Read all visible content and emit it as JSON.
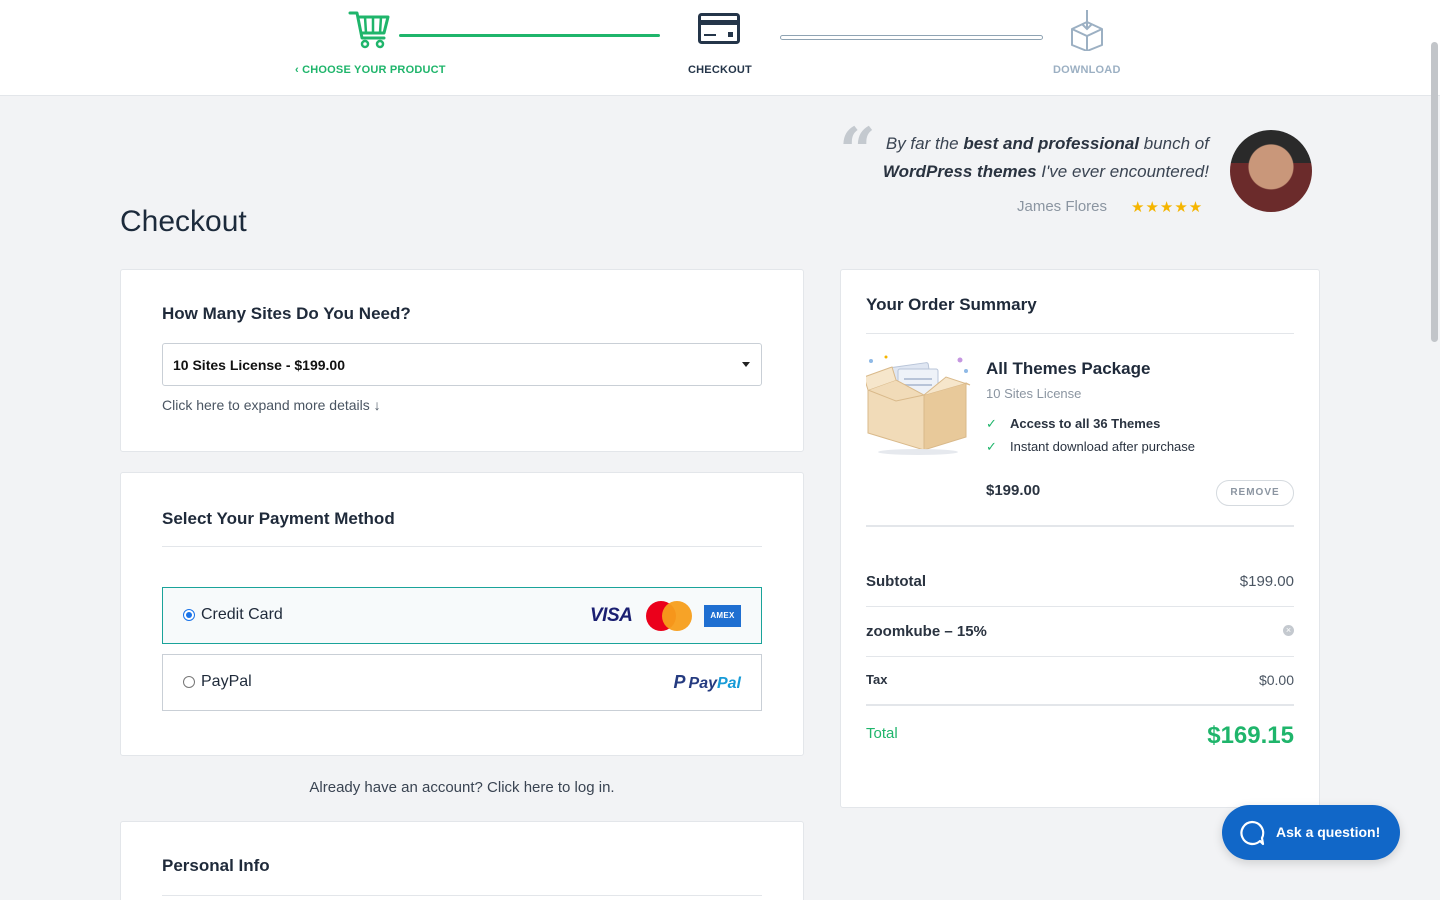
{
  "steps": [
    {
      "label": "‹ CHOOSE YOUR PRODUCT",
      "state": "done",
      "icon": "cart-icon"
    },
    {
      "label": "CHECKOUT",
      "state": "current",
      "icon": "credit-card-icon"
    },
    {
      "label": "DOWNLOAD",
      "state": "upcoming",
      "icon": "box-download-icon"
    }
  ],
  "testimonial": {
    "text_plain_1": "By far the ",
    "text_bold_1": "best and professional",
    "text_plain_2": " bunch of",
    "text_bold_2": "WordPress themes",
    "text_plain_3": " I've ever encountered!",
    "author": "James Flores",
    "stars": "★★★★★",
    "rating": 5
  },
  "page": {
    "title": "Checkout"
  },
  "sites": {
    "heading": "How Many Sites Do You Need?",
    "selected": "10 Sites License - $199.00",
    "expand_link": "Click here to expand more details ↓"
  },
  "payment": {
    "heading": "Select Your Payment Method",
    "options": [
      {
        "label": "Credit Card",
        "selected": true
      },
      {
        "label": "PayPal",
        "selected": false
      }
    ],
    "card_logos": {
      "visa": "VISA",
      "amex": "AMEX"
    },
    "paypal_logo": {
      "pay": "Pay",
      "pal": "Pal"
    }
  },
  "login_prompt": "Already have an account? Click here to log in.",
  "personal": {
    "heading": "Personal Info"
  },
  "summary": {
    "heading": "Your Order Summary",
    "product": {
      "name": "All Themes Package",
      "license": "10 Sites License",
      "features": [
        "Access to all 36 Themes",
        "Instant download after purchase"
      ],
      "price": "$199.00",
      "remove_label": "REMOVE"
    },
    "subtotal": {
      "label": "Subtotal",
      "value": "$199.00"
    },
    "coupon": {
      "label": "zoomkube – 15%",
      "remove": "×"
    },
    "tax": {
      "label": "Tax",
      "value": "$0.00"
    },
    "total": {
      "label": "Total",
      "value": "$169.15"
    }
  },
  "chat": {
    "label": "Ask a question!"
  },
  "colors": {
    "accent_green": "#1fb56b",
    "brand_blue": "#1167c8",
    "teal_border": "#1aa39a"
  }
}
